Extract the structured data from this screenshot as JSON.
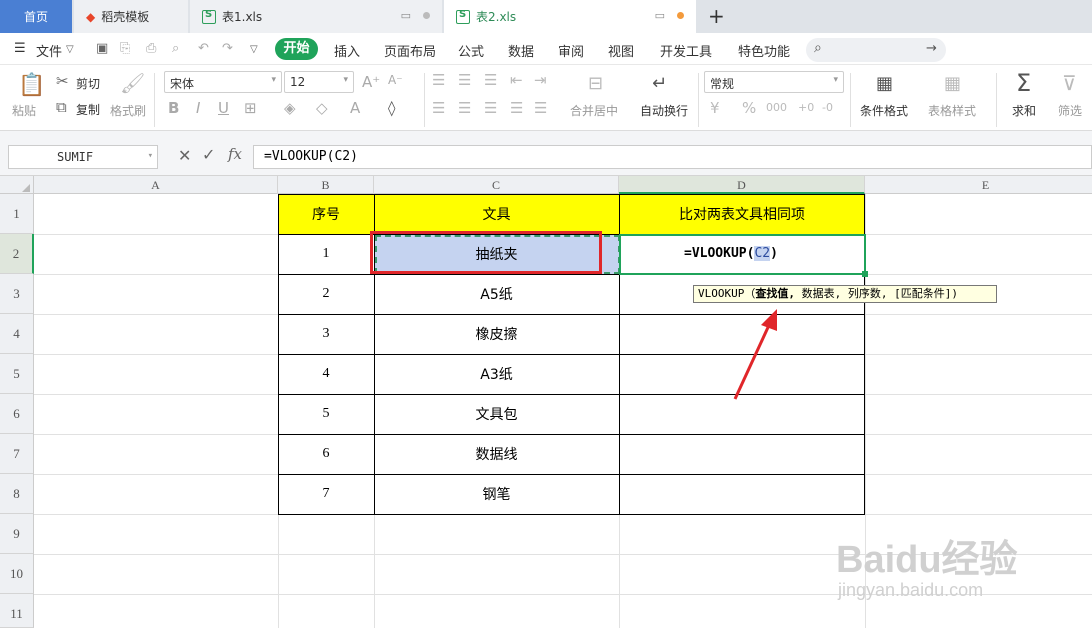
{
  "tabs": {
    "home": "首页",
    "template": "稻壳模板",
    "file1": "表1.xls",
    "file2": "表2.xls",
    "add": "+"
  },
  "menu": {
    "file": "文件",
    "start": "开始",
    "insert": "插入",
    "layout": "页面布局",
    "formula": "公式",
    "data": "数据",
    "review": "审阅",
    "view": "视图",
    "dev": "开发工具",
    "special": "特色功能"
  },
  "ribbon": {
    "paste": "粘贴",
    "cut": "剪切",
    "copy": "复制",
    "format_painter": "格式刷",
    "font_name": "宋体",
    "font_size": "12",
    "merge": "合并居中",
    "wrap": "自动换行",
    "number_format": "常规",
    "cond_format": "条件格式",
    "table_style": "表格样式",
    "sum": "求和",
    "filter": "筛选"
  },
  "formula_bar": {
    "name_box": "SUMIF",
    "formula": "=VLOOKUP(C2)"
  },
  "columns": [
    "A",
    "B",
    "C",
    "D",
    "E"
  ],
  "rows": [
    "1",
    "2",
    "3",
    "4",
    "5",
    "6",
    "7",
    "8",
    "9",
    "10",
    "11"
  ],
  "table": {
    "headers": [
      "序号",
      "文具",
      "比对两表文具相同项"
    ],
    "rows": [
      [
        "1",
        "抽纸夹"
      ],
      [
        "2",
        "A5纸"
      ],
      [
        "3",
        "橡皮擦"
      ],
      [
        "4",
        "A3纸"
      ],
      [
        "5",
        "文具包"
      ],
      [
        "6",
        "数据线"
      ],
      [
        "7",
        "钢笔"
      ]
    ]
  },
  "editing_cell": {
    "prefix": "=VLOOKUP(",
    "ref": "C2",
    "suffix": ")"
  },
  "tooltip": {
    "func": "VLOOKUP",
    "open": "（",
    "arg1": "查找值,",
    "rest": " 数据表, 列序数, [匹配条件])"
  },
  "watermark": {
    "brand": "Baidu经验",
    "url": "jingyan.baidu.com"
  },
  "colors": {
    "header_fill": "#ffff00",
    "selected_fill": "#c5d3f0",
    "highlight_border": "#e0262a",
    "active_green": "#1fa35a",
    "arrow": "#e0262a"
  }
}
